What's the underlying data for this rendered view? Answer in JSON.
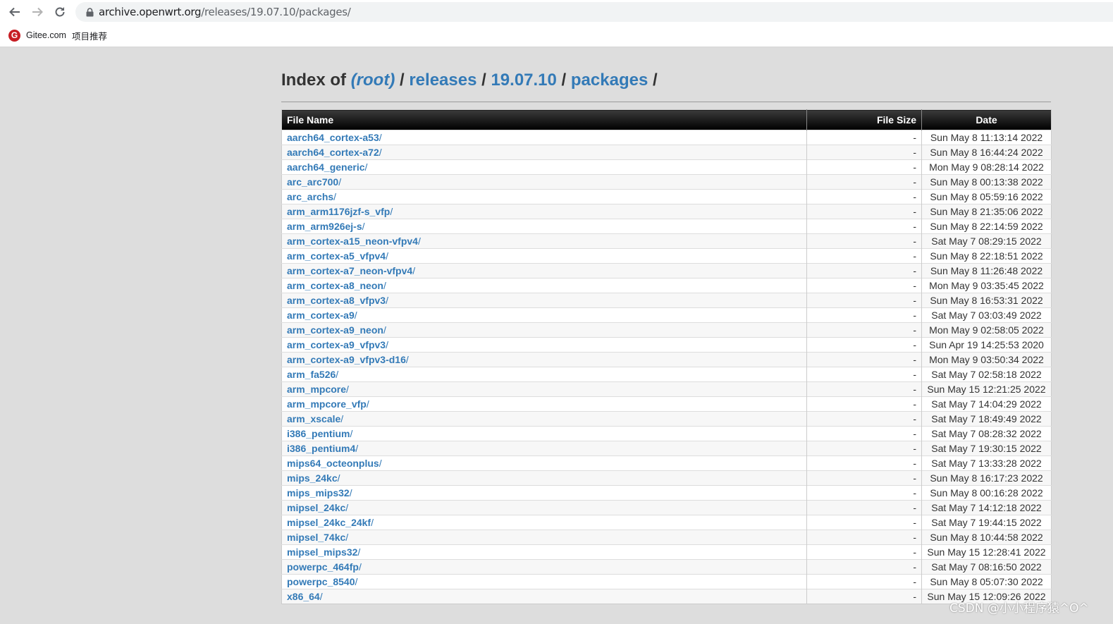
{
  "browser": {
    "url_host": "archive.openwrt.org",
    "url_path": "/releases/19.07.10/packages/",
    "bookmarks": [
      {
        "icon": "gitee-icon",
        "label": "Gitee.com"
      },
      {
        "label": "项目推荐"
      }
    ]
  },
  "page": {
    "title_prefix": "Index of",
    "crumbs": [
      "(root)",
      "releases",
      "19.07.10",
      "packages"
    ],
    "sep": "/"
  },
  "table": {
    "headers": {
      "name": "File Name",
      "size": "File Size",
      "date": "Date"
    },
    "rows": [
      {
        "name": "aarch64_cortex-a53",
        "size": "-",
        "date": "Sun May 8 11:13:14 2022"
      },
      {
        "name": "aarch64_cortex-a72",
        "size": "-",
        "date": "Sun May 8 16:44:24 2022"
      },
      {
        "name": "aarch64_generic",
        "size": "-",
        "date": "Mon May 9 08:28:14 2022"
      },
      {
        "name": "arc_arc700",
        "size": "-",
        "date": "Sun May 8 00:13:38 2022"
      },
      {
        "name": "arc_archs",
        "size": "-",
        "date": "Sun May 8 05:59:16 2022"
      },
      {
        "name": "arm_arm1176jzf-s_vfp",
        "size": "-",
        "date": "Sun May 8 21:35:06 2022"
      },
      {
        "name": "arm_arm926ej-s",
        "size": "-",
        "date": "Sun May 8 22:14:59 2022"
      },
      {
        "name": "arm_cortex-a15_neon-vfpv4",
        "size": "-",
        "date": "Sat May 7 08:29:15 2022"
      },
      {
        "name": "arm_cortex-a5_vfpv4",
        "size": "-",
        "date": "Sun May 8 22:18:51 2022"
      },
      {
        "name": "arm_cortex-a7_neon-vfpv4",
        "size": "-",
        "date": "Sun May 8 11:26:48 2022"
      },
      {
        "name": "arm_cortex-a8_neon",
        "size": "-",
        "date": "Mon May 9 03:35:45 2022"
      },
      {
        "name": "arm_cortex-a8_vfpv3",
        "size": "-",
        "date": "Sun May 8 16:53:31 2022"
      },
      {
        "name": "arm_cortex-a9",
        "size": "-",
        "date": "Sat May 7 03:03:49 2022"
      },
      {
        "name": "arm_cortex-a9_neon",
        "size": "-",
        "date": "Mon May 9 02:58:05 2022"
      },
      {
        "name": "arm_cortex-a9_vfpv3",
        "size": "-",
        "date": "Sun Apr 19 14:25:53 2020"
      },
      {
        "name": "arm_cortex-a9_vfpv3-d16",
        "size": "-",
        "date": "Mon May 9 03:50:34 2022"
      },
      {
        "name": "arm_fa526",
        "size": "-",
        "date": "Sat May 7 02:58:18 2022"
      },
      {
        "name": "arm_mpcore",
        "size": "-",
        "date": "Sun May 15 12:21:25 2022"
      },
      {
        "name": "arm_mpcore_vfp",
        "size": "-",
        "date": "Sat May 7 14:04:29 2022"
      },
      {
        "name": "arm_xscale",
        "size": "-",
        "date": "Sat May 7 18:49:49 2022"
      },
      {
        "name": "i386_pentium",
        "size": "-",
        "date": "Sat May 7 08:28:32 2022"
      },
      {
        "name": "i386_pentium4",
        "size": "-",
        "date": "Sat May 7 19:30:15 2022"
      },
      {
        "name": "mips64_octeonplus",
        "size": "-",
        "date": "Sat May 7 13:33:28 2022"
      },
      {
        "name": "mips_24kc",
        "size": "-",
        "date": "Sun May 8 16:17:23 2022"
      },
      {
        "name": "mips_mips32",
        "size": "-",
        "date": "Sun May 8 00:16:28 2022"
      },
      {
        "name": "mipsel_24kc",
        "size": "-",
        "date": "Sat May 7 14:12:18 2022"
      },
      {
        "name": "mipsel_24kc_24kf",
        "size": "-",
        "date": "Sat May 7 19:44:15 2022"
      },
      {
        "name": "mipsel_74kc",
        "size": "-",
        "date": "Sun May 8 10:44:58 2022"
      },
      {
        "name": "mipsel_mips32",
        "size": "-",
        "date": "Sun May 15 12:28:41 2022"
      },
      {
        "name": "powerpc_464fp",
        "size": "-",
        "date": "Sat May 7 08:16:50 2022"
      },
      {
        "name": "powerpc_8540",
        "size": "-",
        "date": "Sun May 8 05:07:30 2022"
      },
      {
        "name": "x86_64",
        "size": "-",
        "date": "Sun May 15 12:09:26 2022"
      }
    ]
  },
  "watermark": "CSDN @小小程序猿^O^"
}
